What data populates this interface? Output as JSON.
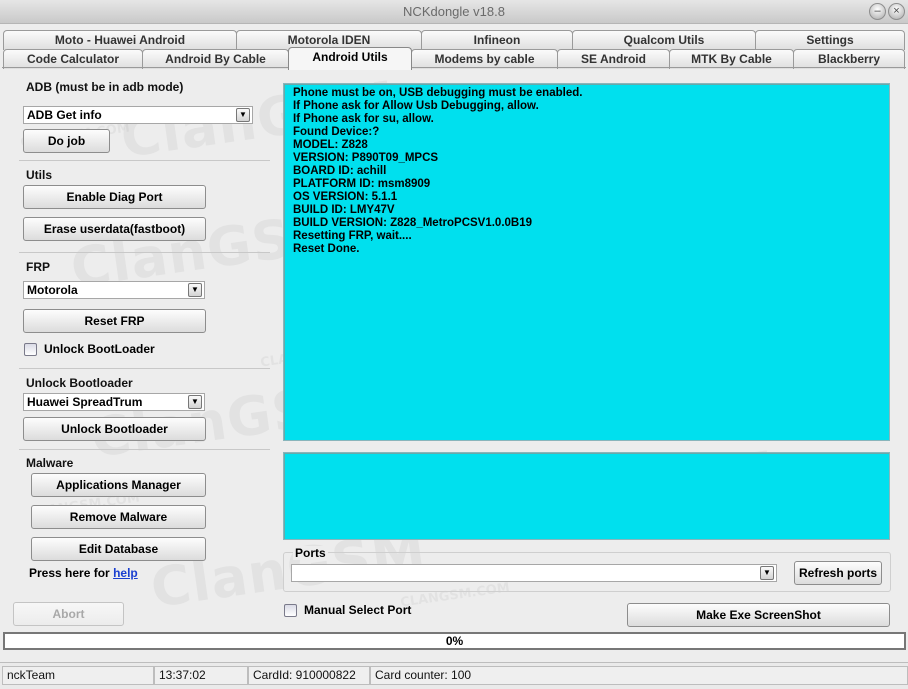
{
  "window": {
    "title": "NCKdongle v18.8"
  },
  "tabs_row1": [
    "Moto - Huawei Android",
    "Motorola IDEN",
    "Infineon",
    "Qualcom Utils",
    "Settings"
  ],
  "tabs_row2": [
    "Code Calculator",
    "Android By Cable",
    "Android Utils",
    "Modems by cable",
    "SE Android",
    "MTK By Cable",
    "Blackberry"
  ],
  "active_tab": "Android Utils",
  "adb": {
    "label": "ADB (must be in adb mode)",
    "selected": "ADB Get info",
    "do_job": "Do job"
  },
  "utils": {
    "label": "Utils",
    "enable_diag": "Enable Diag Port",
    "erase_userdata": "Erase userdata(fastboot)"
  },
  "frp": {
    "label": "FRP",
    "selected": "Motorola",
    "reset": "Reset FRP",
    "unlock_checkbox": "Unlock BootLoader"
  },
  "unlock_bootloader": {
    "label": "Unlock Bootloader",
    "selected": "Huawei SpreadTrum",
    "button": "Unlock Bootloader"
  },
  "malware": {
    "label": "Malware",
    "apps_manager": "Applications Manager",
    "remove": "Remove Malware",
    "edit_db": "Edit Database"
  },
  "help": {
    "prefix": "Press here for",
    "link": "help"
  },
  "abort": "Abort",
  "log_lines": [
    "Phone must be on, USB debugging must be enabled.",
    "If Phone ask for Allow Usb Debugging, allow.",
    "If Phone ask for su, allow.",
    "Found Device:?",
    "MODEL: Z828",
    "VERSION: P890T09_MPCS",
    "BOARD ID: achill",
    "PLATFORM ID: msm8909",
    "OS VERSION: 5.1.1",
    "BUILD ID: LMY47V",
    "BUILD VERSION: Z828_MetroPCSV1.0.0B19",
    "Resetting FRP, wait....",
    "Reset Done."
  ],
  "ports": {
    "label": "Ports",
    "selected": "",
    "refresh": "Refresh ports",
    "manual_select": "Manual Select Port"
  },
  "screenshot_button": "Make Exe ScreenShot",
  "progress": {
    "text": "0%",
    "value": 0
  },
  "status": {
    "user": "nckTeam",
    "time": "13:37:02",
    "card_id": "CardId: 910000822",
    "card_counter": "Card counter: 100"
  },
  "colors": {
    "log_bg": "#00e0ee",
    "link": "#1a3fd0"
  },
  "watermark_text": {
    "big": "ClanGSM",
    "small": "CLANGSM.COM"
  }
}
